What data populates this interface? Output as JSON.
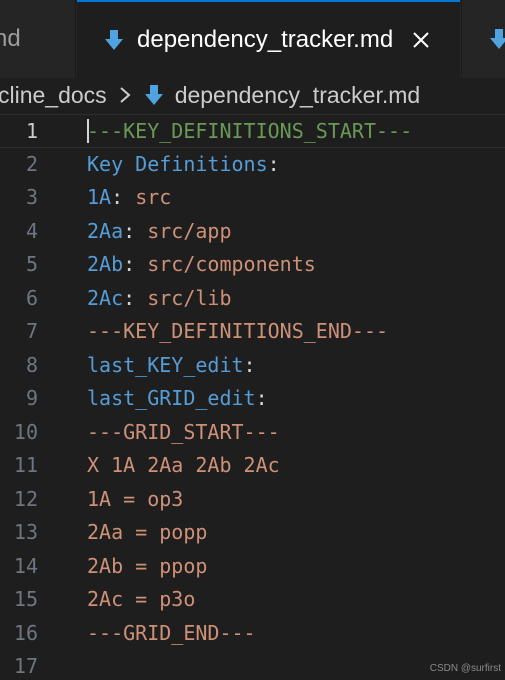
{
  "tabs": {
    "previous_label": "nd",
    "active_label": "dependency_tracker.md",
    "next_icon": "markdown-file-icon"
  },
  "breadcrumb": {
    "folder": "cline_docs",
    "file": "dependency_tracker.md"
  },
  "editor": {
    "current_line": 1,
    "lines": [
      {
        "n": "1",
        "segments": [
          [
            "comment",
            "---KEY_DEFINITIONS_START---"
          ]
        ]
      },
      {
        "n": "2",
        "segments": [
          [
            "key",
            "Key Definitions"
          ],
          [
            "punct",
            ":"
          ]
        ]
      },
      {
        "n": "3",
        "segments": [
          [
            "key",
            "1A"
          ],
          [
            "punct",
            ": "
          ],
          [
            "str",
            "src"
          ]
        ]
      },
      {
        "n": "4",
        "segments": [
          [
            "key",
            "2Aa"
          ],
          [
            "punct",
            ": "
          ],
          [
            "str",
            "src/app"
          ]
        ]
      },
      {
        "n": "5",
        "segments": [
          [
            "key",
            "2Ab"
          ],
          [
            "punct",
            ": "
          ],
          [
            "str",
            "src/components"
          ]
        ]
      },
      {
        "n": "6",
        "segments": [
          [
            "key",
            "2Ac"
          ],
          [
            "punct",
            ": "
          ],
          [
            "str",
            "src/lib"
          ]
        ]
      },
      {
        "n": "7",
        "segments": [
          [
            "str",
            "---KEY_DEFINITIONS_END---"
          ]
        ]
      },
      {
        "n": "8",
        "segments": [
          [
            "key",
            "last_KEY_edit"
          ],
          [
            "punct",
            ":"
          ]
        ]
      },
      {
        "n": "9",
        "segments": [
          [
            "key",
            "last_GRID_edit"
          ],
          [
            "punct",
            ":"
          ]
        ]
      },
      {
        "n": "10",
        "segments": [
          [
            "str",
            "---GRID_START---"
          ]
        ]
      },
      {
        "n": "11",
        "segments": [
          [
            "str",
            "X 1A 2Aa 2Ab 2Ac"
          ]
        ]
      },
      {
        "n": "12",
        "segments": [
          [
            "str",
            "1A = op3"
          ]
        ]
      },
      {
        "n": "13",
        "segments": [
          [
            "str",
            "2Aa = popp"
          ]
        ]
      },
      {
        "n": "14",
        "segments": [
          [
            "str",
            "2Ab = ppop"
          ]
        ]
      },
      {
        "n": "15",
        "segments": [
          [
            "str",
            "2Ac = p3o"
          ]
        ]
      },
      {
        "n": "16",
        "segments": [
          [
            "str",
            "---GRID_END---"
          ]
        ]
      },
      {
        "n": "17",
        "segments": []
      }
    ]
  },
  "watermark": "CSDN @surfirst",
  "colors": {
    "accent": "#0078d4",
    "comment": "#6a9955",
    "key": "#569cd6",
    "string": "#ce9178",
    "markdown_icon": "#4fa3e0"
  }
}
